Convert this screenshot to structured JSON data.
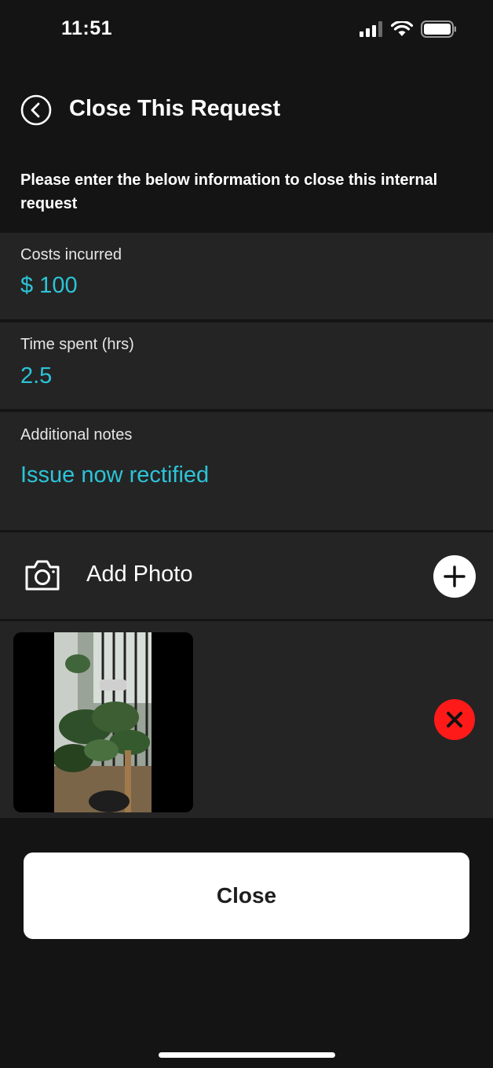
{
  "status_bar": {
    "time": "11:51",
    "icons": [
      "cellular-signal-icon",
      "wifi-icon",
      "battery-icon"
    ]
  },
  "nav": {
    "back_icon": "chevron-left-circle-icon",
    "title": "Close This Request"
  },
  "instructions": "Please enter the below information to close this internal request",
  "fields": {
    "costs": {
      "label": "Costs incurred",
      "value": "$ 100"
    },
    "time": {
      "label": "Time spent (hrs)",
      "value": "2.5"
    },
    "notes": {
      "label": "Additional notes",
      "value": "Issue now rectified"
    }
  },
  "photo": {
    "camera_icon": "camera-icon",
    "add_label": "Add Photo",
    "add_icon": "plus-icon",
    "remove_icon": "close-icon"
  },
  "close_button": "Close",
  "colors": {
    "background": "#141414",
    "panel": "#242424",
    "accent": "#2cc4d8",
    "danger": "#ff1a1a"
  }
}
